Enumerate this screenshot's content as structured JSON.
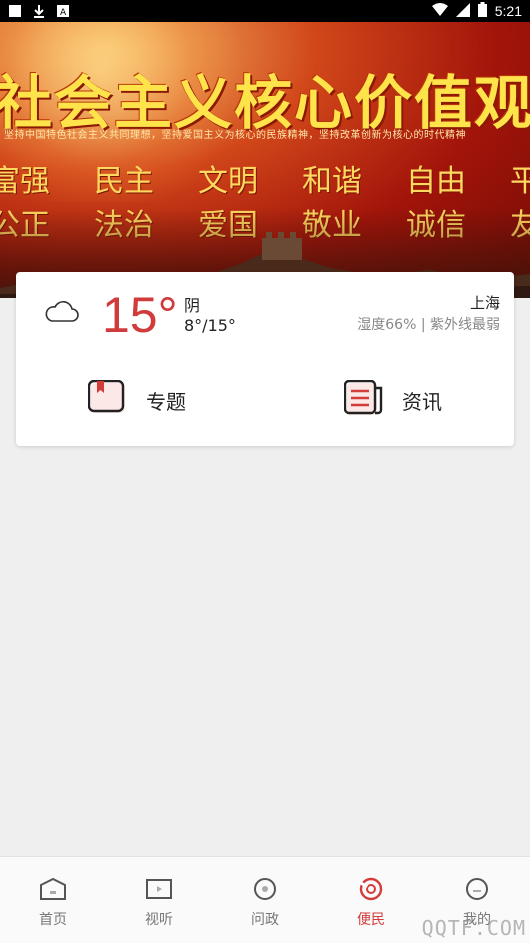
{
  "status_bar": {
    "time": "5:21"
  },
  "banner": {
    "title": "社会主义核心价值观",
    "slogan": "坚持中国特色社会主义共同理想，坚持爱国主义为核心的民族精神，坚持改革创新为核心的时代精神",
    "values_row1": [
      "富强",
      "民主",
      "文明",
      "和谐",
      "自由",
      "平等"
    ],
    "values_row2": [
      "公正",
      "法治",
      "爱国",
      "敬业",
      "诚信",
      "友善"
    ]
  },
  "weather": {
    "temperature": "15°",
    "condition": "阴",
    "range": "8°/15°",
    "city": "上海",
    "detail": "湿度66% | 紫外线最弱",
    "icon": "cloud-icon"
  },
  "shortcuts": [
    {
      "label": "专题",
      "icon": "bookmark-book-icon"
    },
    {
      "label": "资讯",
      "icon": "newspaper-icon"
    }
  ],
  "bottom_nav": {
    "items": [
      {
        "label": "首页",
        "icon": "home-icon"
      },
      {
        "label": "视听",
        "icon": "tv-icon"
      },
      {
        "label": "问政",
        "icon": "question-circle-icon"
      },
      {
        "label": "便民",
        "icon": "service-circle-icon"
      },
      {
        "label": "我的",
        "icon": "profile-icon"
      }
    ],
    "active_index": 3
  },
  "colors": {
    "accent": "#d43b3b",
    "temperature": "#d13b3b"
  },
  "watermark": "QQTF.COM"
}
